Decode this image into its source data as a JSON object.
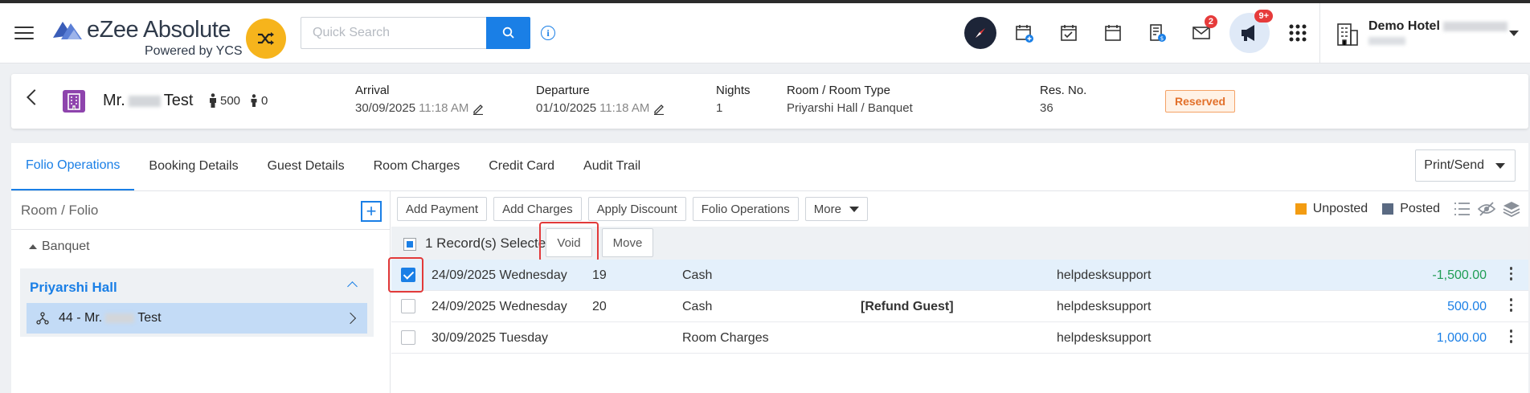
{
  "app": {
    "logo_name": "eZee Absolute",
    "logo_sub": "Powered by YCS",
    "search_placeholder": "Quick Search",
    "mail_badge": "2",
    "announce_badge": "9+",
    "hotel_name": "Demo Hotel"
  },
  "reservation": {
    "guest_prefix": "Mr.",
    "guest_last": "Test",
    "adults": "500",
    "children": "0",
    "arrival_label": "Arrival",
    "arrival_date": "30/09/2025",
    "arrival_time": "11:18 AM",
    "departure_label": "Departure",
    "departure_date": "01/10/2025",
    "departure_time": "11:18 AM",
    "nights_label": "Nights",
    "nights": "1",
    "room_label": "Room / Room Type",
    "room_value": "Priyarshi Hall / Banquet",
    "resno_label": "Res. No.",
    "resno": "36",
    "status": "Reserved"
  },
  "tabs": [
    "Folio Operations",
    "Booking Details",
    "Guest Details",
    "Room Charges",
    "Credit Card",
    "Audit Trail"
  ],
  "print_send": "Print/Send",
  "folio_panel": {
    "header": "Room / Folio",
    "group": "Banquet",
    "room": "Priyarshi Hall",
    "item_prefix": "44 - Mr.",
    "item_suffix": "Test"
  },
  "actions": {
    "add_payment": "Add Payment",
    "add_charges": "Add Charges",
    "apply_discount": "Apply Discount",
    "folio_operations": "Folio Operations",
    "more": "More"
  },
  "legend": {
    "unposted": "Unposted",
    "unposted_color": "#f39c12",
    "posted": "Posted",
    "posted_color": "#5a6a82"
  },
  "selection": {
    "text": "1 Record(s) Selected",
    "void": "Void",
    "move": "Move"
  },
  "transactions": [
    {
      "date": "24/09/2025 Wednesday",
      "ref": "19",
      "type": "Cash",
      "note": "",
      "user": "helpdesksupport",
      "amount": "-1,500.00"
    },
    {
      "date": "24/09/2025 Wednesday",
      "ref": "20",
      "type": "Cash",
      "note": "[Refund Guest]",
      "user": "helpdesksupport",
      "amount": "500.00"
    },
    {
      "date": "30/09/2025 Tuesday",
      "ref": "",
      "type": "Room Charges",
      "note": "",
      "user": "helpdesksupport",
      "amount": "1,000.00"
    }
  ]
}
